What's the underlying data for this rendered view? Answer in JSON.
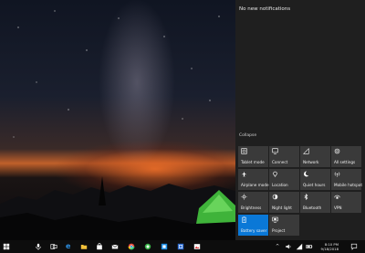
{
  "action_center": {
    "no_notifications": "No new notifications",
    "collapse_label": "Collapse",
    "tiles": [
      {
        "label": "Tablet mode",
        "icon": "tablet-mode-icon",
        "active": false
      },
      {
        "label": "Connect",
        "icon": "connect-icon",
        "active": false
      },
      {
        "label": "Network",
        "icon": "network-icon",
        "active": false
      },
      {
        "label": "All settings",
        "icon": "gear-icon",
        "active": false
      },
      {
        "label": "Airplane mode",
        "icon": "airplane-icon",
        "active": false
      },
      {
        "label": "Location",
        "icon": "location-icon",
        "active": false
      },
      {
        "label": "Quiet hours",
        "icon": "moon-icon",
        "active": false
      },
      {
        "label": "Mobile hotspot",
        "icon": "hotspot-icon",
        "active": false
      },
      {
        "label": "Brightness",
        "icon": "brightness-icon",
        "active": false
      },
      {
        "label": "Night light",
        "icon": "night-light-icon",
        "active": false
      },
      {
        "label": "Bluetooth",
        "icon": "bluetooth-icon",
        "active": false
      },
      {
        "label": "VPN",
        "icon": "vpn-icon",
        "active": false
      },
      {
        "label": "Battery saver",
        "icon": "battery-saver-icon",
        "active": true
      },
      {
        "label": "Project",
        "icon": "project-icon",
        "active": false
      }
    ]
  },
  "taskbar": {
    "time": "8:10 PM",
    "date": "9/18/2018"
  },
  "colors": {
    "accent": "#0a78d7",
    "panel": "#1f1f1f",
    "tile": "#3a3a3a"
  }
}
